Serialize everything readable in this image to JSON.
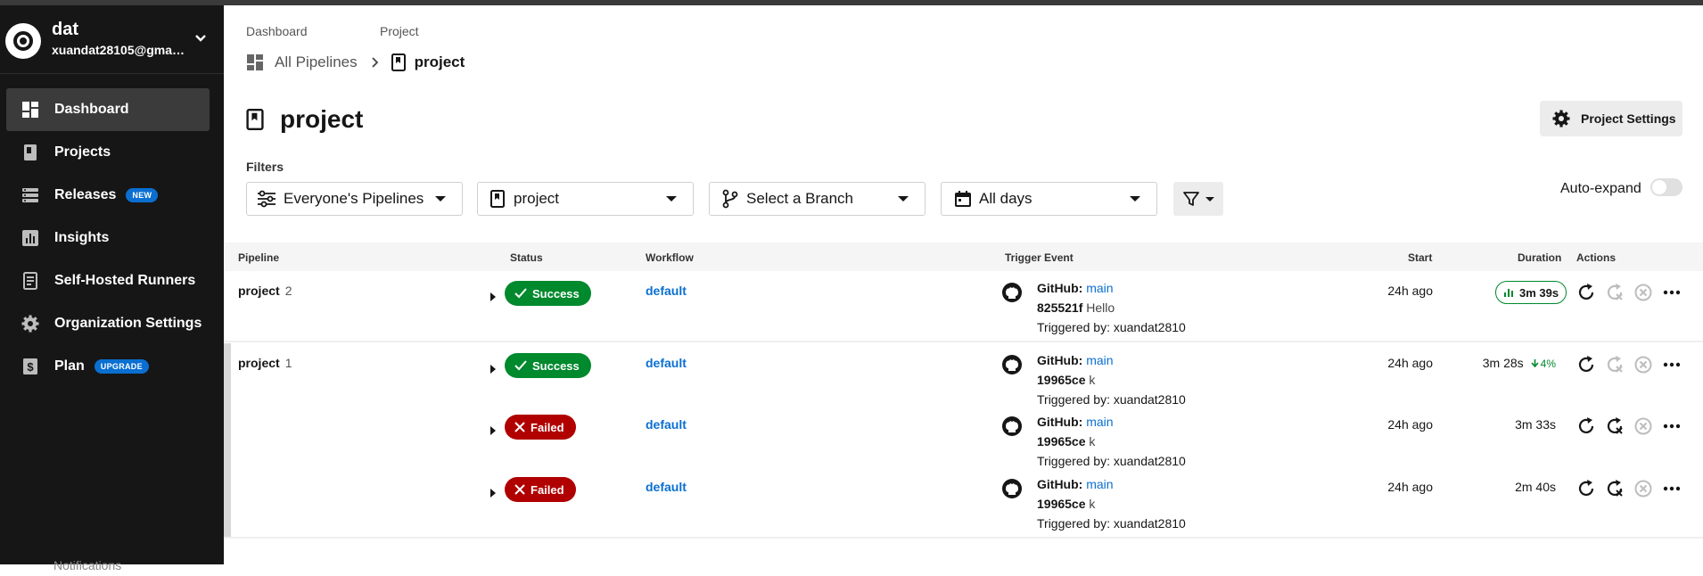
{
  "sidebar": {
    "org_name": "dat",
    "org_email": "xuandat28105@gmai...",
    "items": [
      {
        "label": "Dashboard",
        "icon": "dashboard-icon",
        "badge": ""
      },
      {
        "label": "Projects",
        "icon": "projects-icon",
        "badge": ""
      },
      {
        "label": "Releases",
        "icon": "releases-icon",
        "badge": "NEW"
      },
      {
        "label": "Insights",
        "icon": "insights-icon",
        "badge": ""
      },
      {
        "label": "Self-Hosted Runners",
        "icon": "runners-icon",
        "badge": ""
      },
      {
        "label": "Organization Settings",
        "icon": "gear-icon",
        "badge": ""
      },
      {
        "label": "Plan",
        "icon": "dollar-icon",
        "badge": "UPGRADE"
      }
    ],
    "bottom_label": "Notifications"
  },
  "breadcrumb": {
    "label1": "Dashboard",
    "label2": "Project",
    "link1": "All Pipelines",
    "link2": "project"
  },
  "page": {
    "title": "project",
    "settings_label": "Project Settings"
  },
  "filters": {
    "label": "Filters",
    "pipelines": "Everyone's Pipelines",
    "project": "project",
    "branch": "Select a Branch",
    "days": "All days",
    "auto_expand": "Auto-expand"
  },
  "table": {
    "headers": {
      "pipeline": "Pipeline",
      "status": "Status",
      "workflow": "Workflow",
      "trigger": "Trigger Event",
      "start": "Start",
      "duration": "Duration",
      "actions": "Actions"
    },
    "rows": [
      {
        "pipeline": "project",
        "num": "2",
        "status": "Success",
        "workflow": "default",
        "trigger_src": "GitHub:",
        "branch": "main",
        "commit": "825521f",
        "message": "Hello",
        "triggered_by": "Triggered by: xuandat2810",
        "start": "24h ago",
        "duration": "3m 39s",
        "trend": ""
      },
      {
        "pipeline": "project",
        "num": "1",
        "status": "Success",
        "workflow": "default",
        "trigger_src": "GitHub:",
        "branch": "main",
        "commit": "19965ce",
        "message": "k",
        "triggered_by": "Triggered by: xuandat2810",
        "start": "24h ago",
        "duration": "3m 28s",
        "trend": "4%"
      },
      {
        "pipeline": "",
        "num": "",
        "status": "Failed",
        "workflow": "default",
        "trigger_src": "GitHub:",
        "branch": "main",
        "commit": "19965ce",
        "message": "k",
        "triggered_by": "Triggered by: xuandat2810",
        "start": "24h ago",
        "duration": "3m 33s",
        "trend": ""
      },
      {
        "pipeline": "",
        "num": "",
        "status": "Failed",
        "workflow": "default",
        "trigger_src": "GitHub:",
        "branch": "main",
        "commit": "19965ce",
        "message": "k",
        "triggered_by": "Triggered by: xuandat2810",
        "start": "24h ago",
        "duration": "2m 40s",
        "trend": ""
      }
    ]
  },
  "colors": {
    "sidebar_bg": "#161616",
    "success": "#00892d",
    "failed": "#b00000",
    "link": "#0a6fd1",
    "badge": "#0a6fd1"
  }
}
